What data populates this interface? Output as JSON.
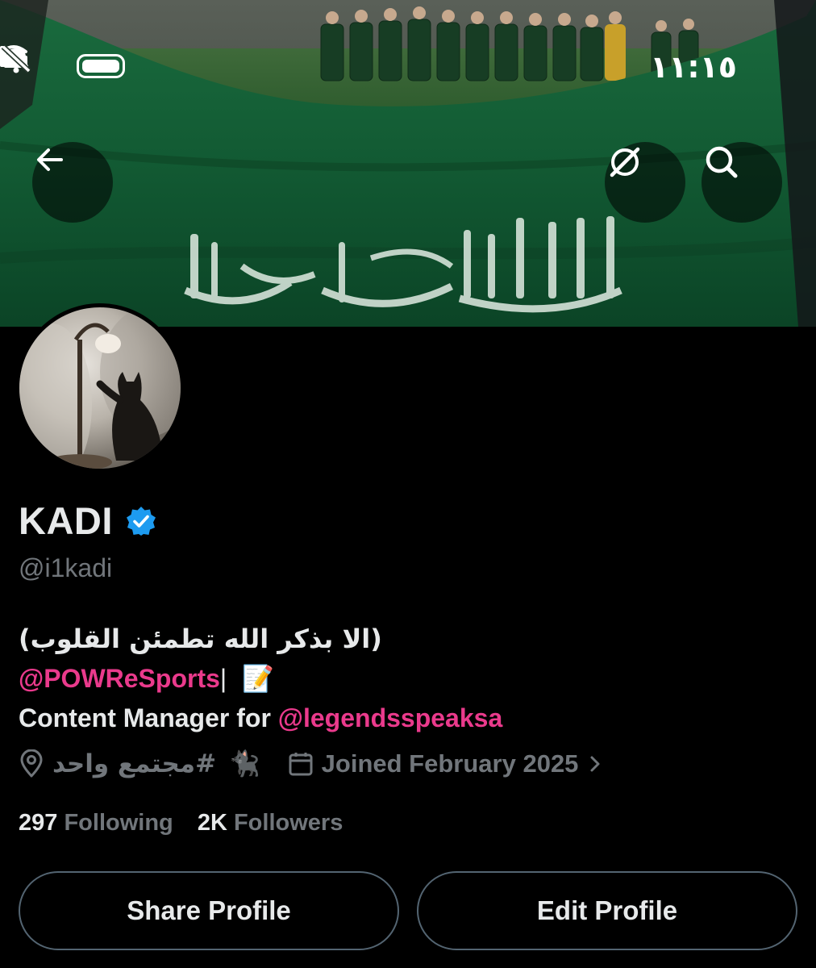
{
  "status_bar": {
    "time": "١١:١٥"
  },
  "header": {
    "back_icon": "arrow-left-icon",
    "grok_icon": "grok-icon",
    "search_icon": "search-icon"
  },
  "banner": {
    "flag_text": "لا إله إلا الله محمد رسول الله"
  },
  "profile": {
    "name": "KADI",
    "handle": "@i1kadi",
    "verified_color": "#1d9bf0",
    "bio": {
      "line1": "(الا بذكر الله تطمئن القلوب)",
      "line2_mention": "@POWReSports",
      "line2_sep": "|",
      "line2_emoji": "📝",
      "line3_prefix": "Content Manager for ",
      "line3_mention": "@legendsspeaksa"
    },
    "location": "#مجتمع واحد",
    "location_emoji": "🐈‍⬛",
    "joined": "Joined February 2025",
    "following_count": "297",
    "following_label": "Following",
    "followers_count": "2K",
    "followers_label": "Followers"
  },
  "actions": {
    "share_label": "Share Profile",
    "edit_label": "Edit Profile"
  },
  "colors": {
    "background": "#000000",
    "mention": "#ea3a8c",
    "muted": "#71767b",
    "flag_green": "#135a34"
  }
}
